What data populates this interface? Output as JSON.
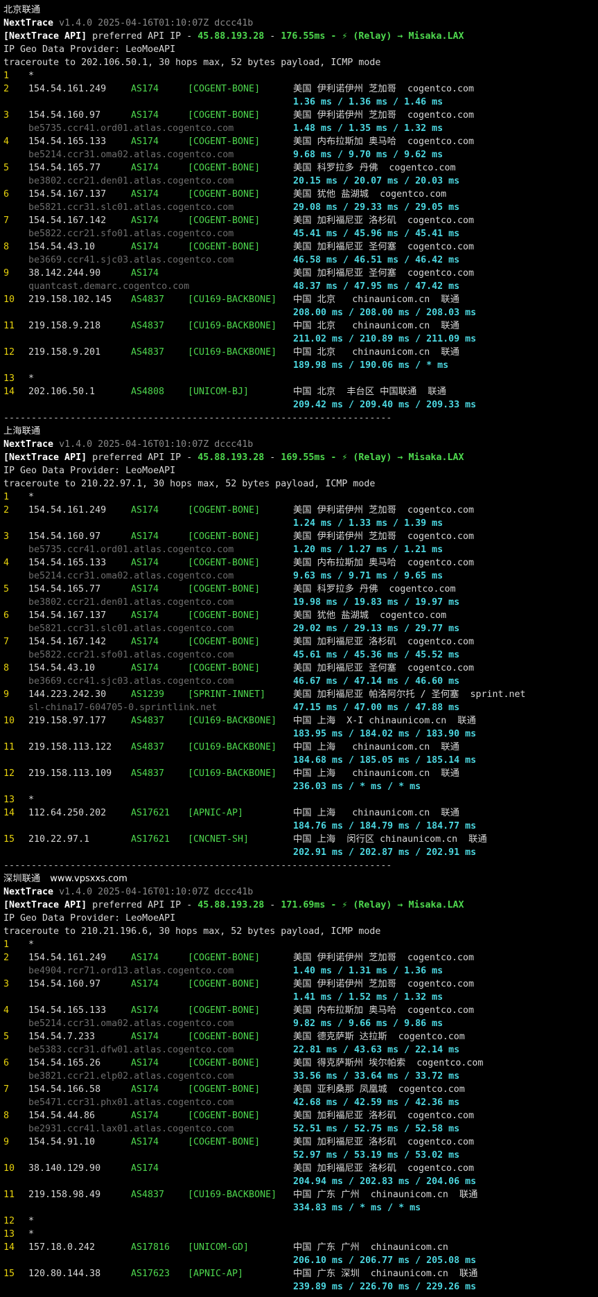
{
  "site_watermark": "www.vpsxxs.com",
  "sections": [
    {
      "title": "北京联通",
      "site_watermark": "",
      "version_tool": "NextTrace",
      "version_rest": " v1.4.0 2025-04-16T01:10:07Z dccc41b",
      "api_label": "[NextTrace API]",
      "api_text": " preferred API IP - ",
      "api_ip": "45.88.193.28",
      "api_dash": " - ",
      "api_latency": "176.55ms",
      "api_relay": " - ⚡ (Relay) → Misaka.LAX",
      "geo_provider": "IP Geo Data Provider: LeoMoeAPI",
      "trace_line": "traceroute to 202.106.50.1, 30 hops max, 52 bytes payload, ICMP mode",
      "hops": [
        {
          "n": "1",
          "ip": "*"
        },
        {
          "n": "2",
          "ip": "154.54.161.249",
          "as": "AS174",
          "tag": "[COGENT-BONE]",
          "geo": "美国 伊利诺伊州 芝加哥  cogentco.com",
          "rtt": "1.36 ms / 1.36 ms / 1.46 ms"
        },
        {
          "n": "3",
          "ip": "154.54.160.97",
          "as": "AS174",
          "tag": "[COGENT-BONE]",
          "geo": "美国 伊利诺伊州 芝加哥  cogentco.com",
          "host": "be5735.ccr41.ord01.atlas.cogentco.com",
          "rtt": "1.48 ms / 1.35 ms / 1.32 ms"
        },
        {
          "n": "4",
          "ip": "154.54.165.133",
          "as": "AS174",
          "tag": "[COGENT-BONE]",
          "geo": "美国 内布拉斯加 奥马哈  cogentco.com",
          "host": "be5214.ccr31.oma02.atlas.cogentco.com",
          "rtt": "9.68 ms / 9.70 ms / 9.62 ms"
        },
        {
          "n": "5",
          "ip": "154.54.165.77",
          "as": "AS174",
          "tag": "[COGENT-BONE]",
          "geo": "美国 科罗拉多 丹佛  cogentco.com",
          "host": "be3802.ccr21.den01.atlas.cogentco.com",
          "rtt": "20.15 ms / 20.07 ms / 20.03 ms"
        },
        {
          "n": "6",
          "ip": "154.54.167.137",
          "as": "AS174",
          "tag": "[COGENT-BONE]",
          "geo": "美国 犹他 盐湖城  cogentco.com",
          "host": "be5821.ccr31.slc01.atlas.cogentco.com",
          "rtt": "29.08 ms / 29.33 ms / 29.05 ms"
        },
        {
          "n": "7",
          "ip": "154.54.167.142",
          "as": "AS174",
          "tag": "[COGENT-BONE]",
          "geo": "美国 加利福尼亚 洛杉矶  cogentco.com",
          "host": "be5822.ccr21.sfo01.atlas.cogentco.com",
          "rtt": "45.41 ms / 45.96 ms / 45.41 ms"
        },
        {
          "n": "8",
          "ip": "154.54.43.10",
          "as": "AS174",
          "tag": "[COGENT-BONE]",
          "geo": "美国 加利福尼亚 圣何塞  cogentco.com",
          "host": "be3669.ccr41.sjc03.atlas.cogentco.com",
          "rtt": "46.58 ms / 46.51 ms / 46.42 ms"
        },
        {
          "n": "9",
          "ip": "38.142.244.90",
          "as": "AS174",
          "tag": "",
          "geo": "美国 加利福尼亚 圣何塞  cogentco.com",
          "host": "quantcast.demarc.cogentco.com",
          "rtt": "48.37 ms / 47.95 ms / 47.42 ms"
        },
        {
          "n": "10",
          "ip": "219.158.102.145",
          "as": "AS4837",
          "tag": "[CU169-BACKBONE]",
          "geo": "中国 北京   chinaunicom.cn  联通",
          "rtt": "208.00 ms / 208.00 ms / 208.03 ms"
        },
        {
          "n": "11",
          "ip": "219.158.9.218",
          "as": "AS4837",
          "tag": "[CU169-BACKBONE]",
          "geo": "中国 北京   chinaunicom.cn  联通",
          "rtt": "211.02 ms / 210.89 ms / 211.09 ms"
        },
        {
          "n": "12",
          "ip": "219.158.9.201",
          "as": "AS4837",
          "tag": "[CU169-BACKBONE]",
          "geo": "中国 北京   chinaunicom.cn  联通",
          "rtt": "189.98 ms / 190.06 ms / * ms"
        },
        {
          "n": "13",
          "ip": "*"
        },
        {
          "n": "14",
          "ip": "202.106.50.1",
          "as": "AS4808",
          "tag": "[UNICOM-BJ]",
          "geo": "中国 北京  丰台区 中国联通  联通",
          "rtt": "209.42 ms / 209.40 ms / 209.33 ms"
        }
      ]
    },
    {
      "title": "上海联通",
      "site_watermark": "",
      "version_tool": "NextTrace",
      "version_rest": " v1.4.0 2025-04-16T01:10:07Z dccc41b",
      "api_label": "[NextTrace API]",
      "api_text": " preferred API IP - ",
      "api_ip": "45.88.193.28",
      "api_dash": " - ",
      "api_latency": "169.55ms",
      "api_relay": " - ⚡ (Relay) → Misaka.LAX",
      "geo_provider": "IP Geo Data Provider: LeoMoeAPI",
      "trace_line": "traceroute to 210.22.97.1, 30 hops max, 52 bytes payload, ICMP mode",
      "hops": [
        {
          "n": "1",
          "ip": "*"
        },
        {
          "n": "2",
          "ip": "154.54.161.249",
          "as": "AS174",
          "tag": "[COGENT-BONE]",
          "geo": "美国 伊利诺伊州 芝加哥  cogentco.com",
          "rtt": "1.24 ms / 1.33 ms / 1.39 ms"
        },
        {
          "n": "3",
          "ip": "154.54.160.97",
          "as": "AS174",
          "tag": "[COGENT-BONE]",
          "geo": "美国 伊利诺伊州 芝加哥  cogentco.com",
          "host": "be5735.ccr41.ord01.atlas.cogentco.com",
          "rtt": "1.20 ms / 1.27 ms / 1.21 ms"
        },
        {
          "n": "4",
          "ip": "154.54.165.133",
          "as": "AS174",
          "tag": "[COGENT-BONE]",
          "geo": "美国 内布拉斯加 奥马哈  cogentco.com",
          "host": "be5214.ccr31.oma02.atlas.cogentco.com",
          "rtt": "9.63 ms / 9.71 ms / 9.65 ms"
        },
        {
          "n": "5",
          "ip": "154.54.165.77",
          "as": "AS174",
          "tag": "[COGENT-BONE]",
          "geo": "美国 科罗拉多 丹佛  cogentco.com",
          "host": "be3802.ccr21.den01.atlas.cogentco.com",
          "rtt": "19.98 ms / 19.83 ms / 19.97 ms"
        },
        {
          "n": "6",
          "ip": "154.54.167.137",
          "as": "AS174",
          "tag": "[COGENT-BONE]",
          "geo": "美国 犹他 盐湖城  cogentco.com",
          "host": "be5821.ccr31.slc01.atlas.cogentco.com",
          "rtt": "29.02 ms / 29.13 ms / 29.77 ms"
        },
        {
          "n": "7",
          "ip": "154.54.167.142",
          "as": "AS174",
          "tag": "[COGENT-BONE]",
          "geo": "美国 加利福尼亚 洛杉矶  cogentco.com",
          "host": "be5822.ccr21.sfo01.atlas.cogentco.com",
          "rtt": "45.61 ms / 45.36 ms / 45.52 ms"
        },
        {
          "n": "8",
          "ip": "154.54.43.10",
          "as": "AS174",
          "tag": "[COGENT-BONE]",
          "geo": "美国 加利福尼亚 圣何塞  cogentco.com",
          "host": "be3669.ccr41.sjc03.atlas.cogentco.com",
          "rtt": "46.67 ms / 47.14 ms / 46.60 ms"
        },
        {
          "n": "9",
          "ip": "144.223.242.30",
          "as": "AS1239",
          "tag": "[SPRINT-INNET]",
          "geo": "美国 加利福尼亚 帕洛阿尔托 / 圣何塞  sprint.net",
          "host": "sl-china17-604705-0.sprintlink.net",
          "rtt": "47.15 ms / 47.00 ms / 47.88 ms"
        },
        {
          "n": "10",
          "ip": "219.158.97.177",
          "as": "AS4837",
          "tag": "[CU169-BACKBONE]",
          "geo": "中国 上海  X-I chinaunicom.cn  联通",
          "rtt": "183.95 ms / 184.02 ms / 183.90 ms"
        },
        {
          "n": "11",
          "ip": "219.158.113.122",
          "as": "AS4837",
          "tag": "[CU169-BACKBONE]",
          "geo": "中国 上海   chinaunicom.cn  联通",
          "rtt": "184.68 ms / 185.05 ms / 185.14 ms"
        },
        {
          "n": "12",
          "ip": "219.158.113.109",
          "as": "AS4837",
          "tag": "[CU169-BACKBONE]",
          "geo": "中国 上海   chinaunicom.cn  联通",
          "rtt": "236.03 ms / * ms / * ms"
        },
        {
          "n": "13",
          "ip": "*"
        },
        {
          "n": "14",
          "ip": "112.64.250.202",
          "as": "AS17621",
          "tag": "[APNIC-AP]",
          "geo": "中国 上海   chinaunicom.cn  联通",
          "rtt": "184.76 ms / 184.79 ms / 184.77 ms"
        },
        {
          "n": "15",
          "ip": "210.22.97.1",
          "as": "AS17621",
          "tag": "[CNCNET-SH]",
          "geo": "中国 上海  闵行区 chinaunicom.cn  联通",
          "rtt": "202.91 ms / 202.87 ms / 202.91 ms"
        }
      ]
    },
    {
      "title": "深圳联通",
      "site_watermark": "www.vpsxxs.com",
      "version_tool": "NextTrace",
      "version_rest": " v1.4.0 2025-04-16T01:10:07Z dccc41b",
      "api_label": "[NextTrace API]",
      "api_text": " preferred API IP - ",
      "api_ip": "45.88.193.28",
      "api_dash": " - ",
      "api_latency": "171.69ms",
      "api_relay": " - ⚡ (Relay) → Misaka.LAX",
      "geo_provider": "IP Geo Data Provider: LeoMoeAPI",
      "trace_line": "traceroute to 210.21.196.6, 30 hops max, 52 bytes payload, ICMP mode",
      "hops": [
        {
          "n": "1",
          "ip": "*"
        },
        {
          "n": "2",
          "ip": "154.54.161.249",
          "as": "AS174",
          "tag": "[COGENT-BONE]",
          "geo": "美国 伊利诺伊州 芝加哥  cogentco.com",
          "host": "be4904.rcr71.ord13.atlas.cogentco.com",
          "rtt": "1.40 ms / 1.31 ms / 1.36 ms"
        },
        {
          "n": "3",
          "ip": "154.54.160.97",
          "as": "AS174",
          "tag": "[COGENT-BONE]",
          "geo": "美国 伊利诺伊州 芝加哥  cogentco.com",
          "rtt": "1.41 ms / 1.52 ms / 1.32 ms"
        },
        {
          "n": "4",
          "ip": "154.54.165.133",
          "as": "AS174",
          "tag": "[COGENT-BONE]",
          "geo": "美国 内布拉斯加 奥马哈  cogentco.com",
          "host": "be5214.ccr31.oma02.atlas.cogentco.com",
          "rtt": "9.82 ms / 9.66 ms / 9.86 ms"
        },
        {
          "n": "5",
          "ip": "154.54.7.233",
          "as": "AS174",
          "tag": "[COGENT-BONE]",
          "geo": "美国 德克萨斯 达拉斯  cogentco.com",
          "host": "be5383.ccr31.dfw01.atlas.cogentco.com",
          "rtt": "22.81 ms / 43.63 ms / 22.14 ms"
        },
        {
          "n": "6",
          "ip": "154.54.165.26",
          "as": "AS174",
          "tag": "[COGENT-BONE]",
          "geo": "美国 得克萨斯州 埃尔帕索  cogentco.com",
          "host": "be3821.ccr21.elp02.atlas.cogentco.com",
          "rtt": "33.56 ms / 33.64 ms / 33.72 ms"
        },
        {
          "n": "7",
          "ip": "154.54.166.58",
          "as": "AS174",
          "tag": "[COGENT-BONE]",
          "geo": "美国 亚利桑那 凤凰城  cogentco.com",
          "host": "be5471.ccr31.phx01.atlas.cogentco.com",
          "rtt": "42.68 ms / 42.59 ms / 42.36 ms"
        },
        {
          "n": "8",
          "ip": "154.54.44.86",
          "as": "AS174",
          "tag": "[COGENT-BONE]",
          "geo": "美国 加利福尼亚 洛杉矶  cogentco.com",
          "host": "be2931.ccr41.lax01.atlas.cogentco.com",
          "rtt": "52.51 ms / 52.75 ms / 52.58 ms"
        },
        {
          "n": "9",
          "ip": "154.54.91.10",
          "as": "AS174",
          "tag": "[COGENT-BONE]",
          "geo": "美国 加利福尼亚 洛杉矶  cogentco.com",
          "rtt": "52.97 ms / 53.19 ms / 53.02 ms"
        },
        {
          "n": "10",
          "ip": "38.140.129.90",
          "as": "AS174",
          "tag": "",
          "geo": "美国 加利福尼亚 洛杉矶  cogentco.com",
          "rtt": "204.94 ms / 202.83 ms / 204.06 ms"
        },
        {
          "n": "11",
          "ip": "219.158.98.49",
          "as": "AS4837",
          "tag": "[CU169-BACKBONE]",
          "geo": "中国 广东 广州  chinaunicom.cn  联通",
          "rtt": "334.83 ms / * ms / * ms"
        },
        {
          "n": "12",
          "ip": "*"
        },
        {
          "n": "13",
          "ip": "*"
        },
        {
          "n": "14",
          "ip": "157.18.0.242",
          "as": "AS17816",
          "tag": "[UNICOM-GD]",
          "geo": "中国 广东 广州  chinaunicom.cn",
          "rtt": "206.10 ms / 206.77 ms / 205.08 ms"
        },
        {
          "n": "15",
          "ip": "120.80.144.38",
          "as": "AS17623",
          "tag": "[APNIC-AP]",
          "geo": "中国 广东 深圳  chinaunicom.cn  联通",
          "rtt": "239.89 ms / 226.70 ms / 229.26 ms"
        }
      ]
    }
  ],
  "separator": "----------------------------------------------------------------------"
}
